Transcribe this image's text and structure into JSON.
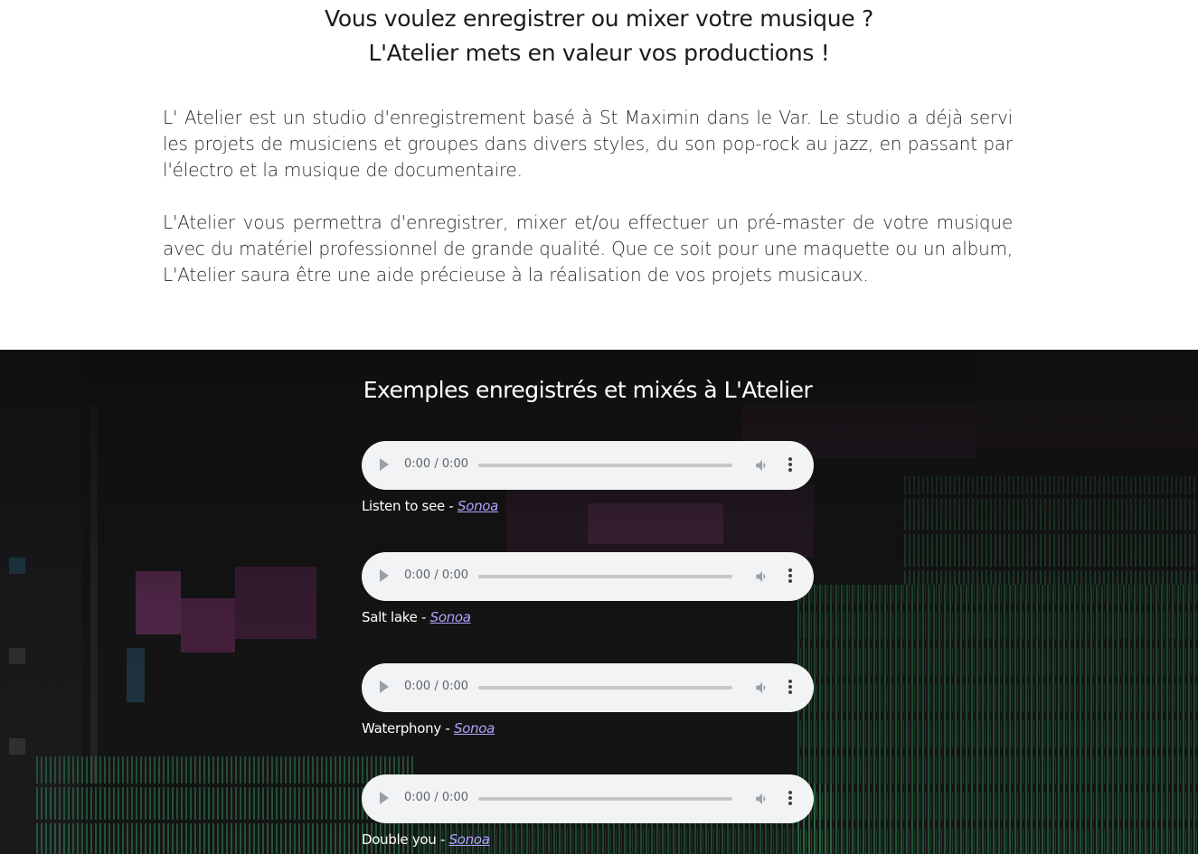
{
  "intro": {
    "headline_line1": "Vous voulez enregistrer ou mixer votre musique ?",
    "headline_line2": "L'Atelier mets en valeur vos productions !",
    "paragraph1": "L' Atelier est un studio d'enregistrement basé à St Maximin dans le Var. Le studio a déjà servi les projets de musiciens et groupes dans divers styles, du son pop-rock au jazz, en passant par l'électro et la musique de documentaire.",
    "paragraph2": "L'Atelier vous permettra d'enregistrer, mixer et/ou effectuer un pré-master de votre musique avec du matériel professionnel de grande qualité. Que ce soit pour une maquette ou un album, L'Atelier saura être une aide précieuse à la réalisation de vos projets musicaux."
  },
  "examples": {
    "title": "Exemples enregistrés et mixés à L'Atelier",
    "tracks": [
      {
        "time": "0:00 / 0:00",
        "title": "Listen to see - ",
        "artist": "Sonoa"
      },
      {
        "time": "0:00 / 0:00",
        "title": "Salt lake - ",
        "artist": "Sonoa"
      },
      {
        "time": "0:00 / 0:00",
        "title": "Waterphony - ",
        "artist": "Sonoa"
      },
      {
        "time": "0:00 / 0:00",
        "title": "Double you - ",
        "artist": "Sonoa"
      }
    ]
  },
  "icons": {
    "play": "play-icon",
    "volume": "volume-icon",
    "more": "more-vertical-icon"
  },
  "colors": {
    "player_bg": "#f1f3f4",
    "link": "#b3a2ff",
    "section_bg": "#141414"
  }
}
